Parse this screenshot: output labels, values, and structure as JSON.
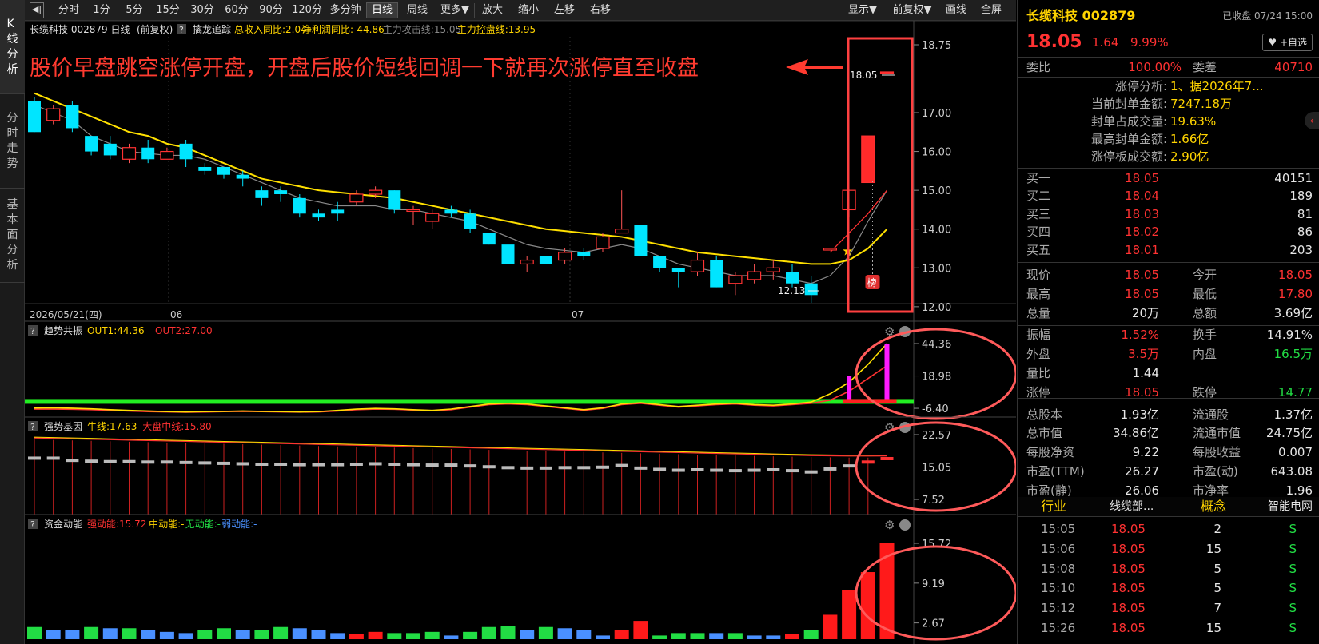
{
  "left_tabs": [
    "K线分析",
    "分时走势",
    "基本面分析"
  ],
  "toolbar": {
    "buttons": [
      "分时",
      "1分",
      "5分",
      "15分",
      "30分",
      "60分",
      "90分",
      "120分",
      "多分钟",
      "日线",
      "周线",
      "更多▼",
      "放大",
      "缩小",
      "左移",
      "右移"
    ],
    "selected": "日线",
    "right_buttons": [
      "显示▼",
      "前复权▼",
      "画线",
      "全屏"
    ]
  },
  "main_info": {
    "stock": "长缆科技 002879 日线",
    "adjust": "(前复权)",
    "help": "?",
    "indicator": "擒龙追踪",
    "items": [
      {
        "label": "总收入同比:",
        "value": "2.04",
        "color": "#ffd400"
      },
      {
        "label": "净利润同比:",
        "value": "-44.86",
        "color": "#ffd400"
      },
      {
        "label": "主力攻击线:",
        "value": "15.05",
        "color": "#888888"
      },
      {
        "label": "主力控盘线:",
        "value": "13.95",
        "color": "#ffd400"
      }
    ]
  },
  "annotation": "股价早盘跳空涨停开盘，开盘后股价短线回调一下就再次涨停直至收盘",
  "price_axis": [
    "18.75",
    "17.00",
    "16.00",
    "15.00",
    "14.00",
    "13.00",
    "12.00"
  ],
  "date_axis": [
    "2026/05/21(四)",
    "06",
    "07"
  ],
  "price_labels": {
    "high": "18.05",
    "low": "12.13"
  },
  "bang_badge": "榜",
  "sub1": {
    "help": "?",
    "name": "趋势共振",
    "items": [
      {
        "label": "OUT1:",
        "value": "44.36",
        "color": "#ffd400"
      },
      {
        "label": "OUT2:",
        "value": "27.00",
        "color": "#ff3232"
      }
    ],
    "axis": [
      "44.36",
      "18.98",
      "-6.40"
    ]
  },
  "sub2": {
    "help": "?",
    "name": "强势基因",
    "items": [
      {
        "label": "牛线:",
        "value": "17.63",
        "color": "#ffd400"
      },
      {
        "label": "大盘中线:",
        "value": "15.80",
        "color": "#ff3232"
      }
    ],
    "axis": [
      "22.57",
      "15.05",
      "7.52"
    ]
  },
  "sub3": {
    "help": "?",
    "name": "资金动能",
    "items": [
      {
        "label": "强动能:",
        "value": "15.72",
        "color": "#ff3232"
      },
      {
        "label": "中动能:",
        "value": "-",
        "color": "#ffd400"
      },
      {
        "label": "无动能:",
        "value": "-",
        "color": "#22dd44"
      },
      {
        "label": "弱动能:",
        "value": "-",
        "color": "#4a90ff"
      }
    ],
    "axis": [
      "15.72",
      "9.19",
      "2.67"
    ]
  },
  "chart_data": {
    "type": "candlestick",
    "candles": [
      {
        "o": 16.5,
        "c": 17.3,
        "h": 17.4,
        "l": 16.5,
        "up": false
      },
      {
        "o": 16.8,
        "c": 17.1,
        "h": 17.2,
        "l": 16.7,
        "up": true
      },
      {
        "o": 17.2,
        "c": 16.6,
        "h": 17.3,
        "l": 16.5,
        "up": false
      },
      {
        "o": 16.4,
        "c": 16.0,
        "h": 16.4,
        "l": 15.9,
        "up": false
      },
      {
        "o": 16.2,
        "c": 15.9,
        "h": 16.4,
        "l": 15.8,
        "up": false
      },
      {
        "o": 15.8,
        "c": 16.1,
        "h": 16.2,
        "l": 15.7,
        "up": true
      },
      {
        "o": 15.8,
        "c": 16.1,
        "h": 16.3,
        "l": 15.7,
        "up": false
      },
      {
        "o": 15.8,
        "c": 16.0,
        "h": 16.1,
        "l": 15.8,
        "up": true
      },
      {
        "o": 16.2,
        "c": 15.8,
        "h": 16.3,
        "l": 15.6,
        "up": false
      },
      {
        "o": 15.6,
        "c": 15.5,
        "h": 15.7,
        "l": 15.4,
        "up": false
      },
      {
        "o": 15.6,
        "c": 15.4,
        "h": 15.6,
        "l": 15.3,
        "up": false
      },
      {
        "o": 15.4,
        "c": 15.3,
        "h": 15.5,
        "l": 15.1,
        "up": false
      },
      {
        "o": 15.0,
        "c": 14.8,
        "h": 15.1,
        "l": 14.6,
        "up": false
      },
      {
        "o": 15.0,
        "c": 14.9,
        "h": 15.1,
        "l": 14.7,
        "up": false
      },
      {
        "o": 14.8,
        "c": 14.4,
        "h": 14.9,
        "l": 14.3,
        "up": false
      },
      {
        "o": 14.4,
        "c": 14.3,
        "h": 14.5,
        "l": 14.2,
        "up": false
      },
      {
        "o": 14.4,
        "c": 14.5,
        "h": 14.7,
        "l": 14.2,
        "up": false
      },
      {
        "o": 14.7,
        "c": 14.9,
        "h": 15.0,
        "l": 14.6,
        "up": true
      },
      {
        "o": 14.9,
        "c": 15.0,
        "h": 15.1,
        "l": 14.8,
        "up": true
      },
      {
        "o": 15.0,
        "c": 14.5,
        "h": 15.0,
        "l": 14.4,
        "up": false
      },
      {
        "o": 14.5,
        "c": 14.5,
        "h": 14.6,
        "l": 14.1,
        "up": true
      },
      {
        "o": 14.2,
        "c": 14.4,
        "h": 14.5,
        "l": 14.0,
        "up": true
      },
      {
        "o": 14.5,
        "c": 14.4,
        "h": 14.6,
        "l": 14.3,
        "up": false
      },
      {
        "o": 14.4,
        "c": 14.0,
        "h": 14.5,
        "l": 13.9,
        "up": false
      },
      {
        "o": 13.9,
        "c": 13.6,
        "h": 13.9,
        "l": 13.6,
        "up": false
      },
      {
        "o": 13.6,
        "c": 13.1,
        "h": 13.7,
        "l": 13.0,
        "up": false
      },
      {
        "o": 13.1,
        "c": 13.2,
        "h": 13.3,
        "l": 12.9,
        "up": true
      },
      {
        "o": 13.3,
        "c": 13.1,
        "h": 13.3,
        "l": 13.1,
        "up": false
      },
      {
        "o": 13.2,
        "c": 13.4,
        "h": 13.5,
        "l": 13.1,
        "up": true
      },
      {
        "o": 13.3,
        "c": 13.4,
        "h": 13.5,
        "l": 13.2,
        "up": false
      },
      {
        "o": 13.5,
        "c": 13.8,
        "h": 13.9,
        "l": 13.4,
        "up": true
      },
      {
        "o": 13.9,
        "c": 14.0,
        "h": 15.0,
        "l": 13.9,
        "up": true
      },
      {
        "o": 14.1,
        "c": 13.3,
        "h": 14.1,
        "l": 13.3,
        "up": false
      },
      {
        "o": 13.3,
        "c": 13.0,
        "h": 13.3,
        "l": 12.9,
        "up": false
      },
      {
        "o": 13.0,
        "c": 12.9,
        "h": 13.0,
        "l": 12.5,
        "up": false
      },
      {
        "o": 12.9,
        "c": 13.2,
        "h": 13.4,
        "l": 12.8,
        "up": true
      },
      {
        "o": 13.2,
        "c": 12.5,
        "h": 13.3,
        "l": 12.5,
        "up": false
      },
      {
        "o": 12.6,
        "c": 12.8,
        "h": 12.9,
        "l": 12.3,
        "up": true
      },
      {
        "o": 12.7,
        "c": 12.9,
        "h": 13.1,
        "l": 12.6,
        "up": true
      },
      {
        "o": 12.9,
        "c": 13.0,
        "h": 13.2,
        "l": 12.7,
        "up": true
      },
      {
        "o": 12.9,
        "c": 12.6,
        "h": 13.1,
        "l": 12.5,
        "up": false
      },
      {
        "o": 12.6,
        "c": 12.3,
        "h": 12.8,
        "l": 12.1,
        "up": false
      },
      {
        "o": 13.5,
        "c": 13.5,
        "h": 13.5,
        "l": 13.5,
        "up": true
      },
      {
        "o": 14.5,
        "c": 15.0,
        "h": 15.0,
        "l": 14.3,
        "up": true
      },
      {
        "o": 15.2,
        "c": 16.4,
        "h": 16.4,
        "l": 15.2,
        "up": true
      },
      {
        "o": 18.05,
        "c": 18.05,
        "h": 18.05,
        "l": 17.8,
        "up": true
      }
    ],
    "ma_yellow": [
      17.5,
      17.3,
      17.1,
      16.9,
      16.7,
      16.5,
      16.4,
      16.2,
      16.1,
      15.9,
      15.7,
      15.5,
      15.3,
      15.2,
      15.1,
      15.0,
      14.95,
      14.9,
      14.85,
      14.8,
      14.7,
      14.6,
      14.5,
      14.4,
      14.3,
      14.2,
      14.1,
      14.0,
      13.95,
      13.9,
      13.85,
      13.8,
      13.7,
      13.6,
      13.5,
      13.4,
      13.35,
      13.3,
      13.25,
      13.2,
      13.15,
      13.1,
      13.1,
      13.2,
      13.5,
      14.0
    ],
    "ma_gray": [
      17.2,
      17.0,
      16.8,
      16.4,
      16.2,
      16.0,
      15.95,
      15.9,
      15.9,
      15.8,
      15.6,
      15.4,
      15.2,
      15.0,
      14.8,
      14.7,
      14.6,
      14.6,
      14.6,
      14.5,
      14.5,
      14.4,
      14.3,
      14.2,
      14.0,
      13.8,
      13.6,
      13.5,
      13.45,
      13.4,
      13.5,
      13.6,
      13.5,
      13.3,
      13.1,
      13.0,
      12.9,
      12.8,
      12.8,
      12.8,
      12.7,
      12.6,
      12.8,
      13.3,
      14.2,
      15.0
    ],
    "sub1_out1": [
      -6.2,
      -6.0,
      -6.3,
      -6.8,
      -7.5,
      -8.0,
      -8.5,
      -9.0,
      -9.2,
      -9.0,
      -8.8,
      -8.5,
      -8.8,
      -9.0,
      -9.2,
      -9.0,
      -8.0,
      -7.0,
      -6.5,
      -6.8,
      -7.5,
      -8.0,
      -7.0,
      -5.0,
      -3.0,
      -2.5,
      -3.0,
      -4.5,
      -6.0,
      -7.5,
      -6.0,
      -3.0,
      -2.0,
      -3.5,
      -5.0,
      -4.0,
      -3.0,
      -2.5,
      -3.5,
      -4.0,
      -3.0,
      -1.5,
      5.0,
      14.0,
      28.0,
      44.36
    ],
    "sub1_out2": [
      -7.0,
      -7.0,
      -7.2,
      -7.5,
      -8.0,
      -8.5,
      -9.0,
      -9.2,
      -9.5,
      -9.3,
      -9.0,
      -8.8,
      -9.0,
      -9.2,
      -9.4,
      -9.2,
      -8.5,
      -7.5,
      -7.0,
      -7.2,
      -7.8,
      -8.2,
      -7.5,
      -5.5,
      -3.5,
      -3.0,
      -3.5,
      -5.0,
      -6.5,
      -8.0,
      -6.5,
      -3.5,
      -2.5,
      -4.0,
      -5.5,
      -4.5,
      -3.5,
      -3.0,
      -4.0,
      -4.5,
      -3.5,
      -2.5,
      0.0,
      7.0,
      17.0,
      27.0
    ],
    "sub1_bars": [
      {
        "i": 43,
        "v": 18.98
      },
      {
        "i": 45,
        "v": 44.36
      }
    ],
    "sub2_bull": [
      21.8,
      21.7,
      21.6,
      21.5,
      21.4,
      21.3,
      21.2,
      21.1,
      21.0,
      20.9,
      20.8,
      20.7,
      20.6,
      20.5,
      20.4,
      20.3,
      20.2,
      20.1,
      20.0,
      19.9,
      19.8,
      19.7,
      19.6,
      19.5,
      19.4,
      19.3,
      19.2,
      19.1,
      19.0,
      18.9,
      18.8,
      18.7,
      18.6,
      18.5,
      18.4,
      18.3,
      18.2,
      18.1,
      18.0,
      17.9,
      17.8,
      17.7,
      17.65,
      17.6,
      17.6,
      17.63
    ],
    "sub2_gray": [
      17.1,
      17.1,
      16.6,
      16.4,
      16.3,
      16.3,
      16.2,
      16.2,
      16.1,
      16.0,
      15.9,
      15.8,
      15.7,
      15.7,
      15.6,
      15.6,
      15.6,
      15.7,
      15.8,
      15.7,
      15.6,
      15.5,
      15.5,
      15.3,
      15.1,
      14.9,
      14.8,
      14.8,
      14.9,
      14.9,
      15.0,
      15.4,
      14.8,
      14.5,
      14.3,
      14.4,
      14.3,
      14.2,
      14.3,
      14.4,
      14.2,
      13.9,
      14.6,
      15.3,
      16.2,
      17.0
    ],
    "sub3_bars": [
      {
        "v": 2.0,
        "c": "#22dd44"
      },
      {
        "v": 1.5,
        "c": "#4a90ff"
      },
      {
        "v": 1.5,
        "c": "#4a90ff"
      },
      {
        "v": 2.0,
        "c": "#22dd44"
      },
      {
        "v": 1.8,
        "c": "#4a90ff"
      },
      {
        "v": 1.8,
        "c": "#22dd44"
      },
      {
        "v": 1.5,
        "c": "#4a90ff"
      },
      {
        "v": 1.2,
        "c": "#4a90ff"
      },
      {
        "v": 1.0,
        "c": "#4a90ff"
      },
      {
        "v": 1.5,
        "c": "#22dd44"
      },
      {
        "v": 1.8,
        "c": "#22dd44"
      },
      {
        "v": 1.5,
        "c": "#4a90ff"
      },
      {
        "v": 1.5,
        "c": "#22dd44"
      },
      {
        "v": 2.0,
        "c": "#22dd44"
      },
      {
        "v": 1.8,
        "c": "#4a90ff"
      },
      {
        "v": 1.5,
        "c": "#4a90ff"
      },
      {
        "v": 1.0,
        "c": "#4a90ff"
      },
      {
        "v": 0.8,
        "c": "#ff1a1a"
      },
      {
        "v": 1.2,
        "c": "#ff1a1a"
      },
      {
        "v": 1.0,
        "c": "#22dd44"
      },
      {
        "v": 1.0,
        "c": "#22dd44"
      },
      {
        "v": 1.2,
        "c": "#22dd44"
      },
      {
        "v": 0.6,
        "c": "#4a90ff"
      },
      {
        "v": 1.2,
        "c": "#22dd44"
      },
      {
        "v": 2.0,
        "c": "#22dd44"
      },
      {
        "v": 2.2,
        "c": "#22dd44"
      },
      {
        "v": 1.5,
        "c": "#4a90ff"
      },
      {
        "v": 2.0,
        "c": "#22dd44"
      },
      {
        "v": 1.8,
        "c": "#4a90ff"
      },
      {
        "v": 1.5,
        "c": "#4a90ff"
      },
      {
        "v": 0.6,
        "c": "#4a90ff"
      },
      {
        "v": 1.5,
        "c": "#ff1a1a"
      },
      {
        "v": 3.0,
        "c": "#ff1a1a"
      },
      {
        "v": 0.6,
        "c": "#22dd44"
      },
      {
        "v": 1.0,
        "c": "#22dd44"
      },
      {
        "v": 1.0,
        "c": "#22dd44"
      },
      {
        "v": 1.0,
        "c": "#4a90ff"
      },
      {
        "v": 1.0,
        "c": "#22dd44"
      },
      {
        "v": 0.6,
        "c": "#4a90ff"
      },
      {
        "v": 0.6,
        "c": "#4a90ff"
      },
      {
        "v": 0.8,
        "c": "#ff1a1a"
      },
      {
        "v": 1.5,
        "c": "#22dd44"
      },
      {
        "v": 4.0,
        "c": "#ff1a1a"
      },
      {
        "v": 8.0,
        "c": "#ff1a1a"
      },
      {
        "v": 11.0,
        "c": "#ff1a1a"
      },
      {
        "v": 15.72,
        "c": "#ff1a1a"
      }
    ]
  },
  "panel": {
    "title": "长缆科技 002879",
    "status": "已收盘 07/24 15:00",
    "price": "18.05",
    "change": "1.64",
    "pct": "9.99%",
    "watch": "+自选",
    "weibi_label": "委比",
    "weibi": "100.00%",
    "weicha_label": "委差",
    "weicha": "40710",
    "limit_analysis": [
      {
        "label": "涨停分析:",
        "value": "1、据2026年7..."
      },
      {
        "label": "当前封单金额:",
        "value": "7247.18万"
      },
      {
        "label": "封单占成交量:",
        "value": "19.63%"
      },
      {
        "label": "最高封单金额:",
        "value": "1.66亿"
      },
      {
        "label": "涨停板成交额:",
        "value": "2.90亿"
      }
    ],
    "bids": [
      {
        "label": "买一",
        "price": "18.05",
        "vol": "40151"
      },
      {
        "label": "买二",
        "price": "18.04",
        "vol": "189"
      },
      {
        "label": "买三",
        "price": "18.03",
        "vol": "81"
      },
      {
        "label": "买四",
        "price": "18.02",
        "vol": "86"
      },
      {
        "label": "买五",
        "price": "18.01",
        "vol": "203"
      }
    ],
    "stats": [
      {
        "l1": "现价",
        "v1": "18.05",
        "c1": "red",
        "l2": "今开",
        "v2": "18.05",
        "c2": "red"
      },
      {
        "l1": "最高",
        "v1": "18.05",
        "c1": "red",
        "l2": "最低",
        "v2": "17.80",
        "c2": "red"
      },
      {
        "l1": "总量",
        "v1": "20万",
        "c1": "white",
        "l2": "总额",
        "v2": "3.69亿",
        "c2": "white"
      },
      {
        "l1": "振幅",
        "v1": "1.52%",
        "c1": "red",
        "l2": "换手",
        "v2": "14.91%",
        "c2": "white"
      },
      {
        "l1": "外盘",
        "v1": "3.5万",
        "c1": "red",
        "l2": "内盘",
        "v2": "16.5万",
        "c2": "green"
      },
      {
        "l1": "量比",
        "v1": "1.44",
        "c1": "white",
        "l2": "",
        "v2": "",
        "c2": "white"
      },
      {
        "l1": "涨停",
        "v1": "18.05",
        "c1": "red",
        "l2": "跌停",
        "v2": "14.77",
        "c2": "green"
      },
      {
        "l1": "总股本",
        "v1": "1.93亿",
        "c1": "white",
        "l2": "流通股",
        "v2": "1.37亿",
        "c2": "white"
      },
      {
        "l1": "总市值",
        "v1": "34.86亿",
        "c1": "white",
        "l2": "流通市值",
        "v2": "24.75亿",
        "c2": "white"
      },
      {
        "l1": "每股净资",
        "v1": "9.22",
        "c1": "white",
        "l2": "每股收益",
        "v2": "0.007",
        "c2": "white"
      },
      {
        "l1": "市盈(TTM)",
        "v1": "26.27",
        "c1": "white",
        "l2": "市盈(动)",
        "v2": "643.08",
        "c2": "white"
      },
      {
        "l1": "市盈(静)",
        "v1": "26.06",
        "c1": "white",
        "l2": "市净率",
        "v2": "1.96",
        "c2": "white"
      }
    ],
    "industry_label": "行业",
    "industry": "线缆部...",
    "concept_label": "概念",
    "concept": "智能电网",
    "ticks": [
      {
        "t": "15:05",
        "p": "18.05",
        "v": "2",
        "s": "S"
      },
      {
        "t": "15:06",
        "p": "18.05",
        "v": "15",
        "s": "S"
      },
      {
        "t": "15:08",
        "p": "18.05",
        "v": "5",
        "s": "S"
      },
      {
        "t": "15:10",
        "p": "18.05",
        "v": "5",
        "s": "S"
      },
      {
        "t": "15:12",
        "p": "18.05",
        "v": "7",
        "s": "S"
      },
      {
        "t": "15:26",
        "p": "18.05",
        "v": "15",
        "s": "S"
      }
    ]
  }
}
